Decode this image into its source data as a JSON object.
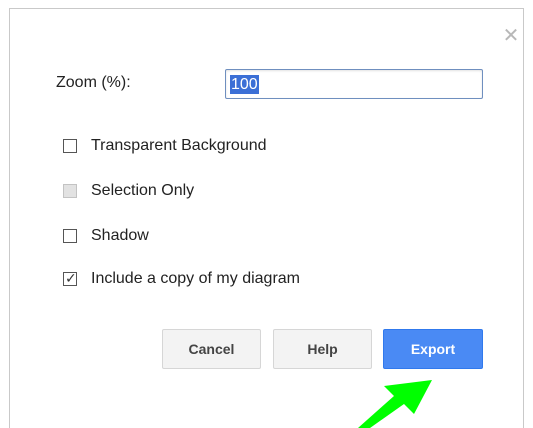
{
  "dialog": {
    "close_icon": "close-icon",
    "zoom_label": "Zoom (%):",
    "zoom_value": "100"
  },
  "options": [
    {
      "label": "Transparent Background",
      "checked": false,
      "disabled": false
    },
    {
      "label": "Selection Only",
      "checked": false,
      "disabled": true
    },
    {
      "label": "Shadow",
      "checked": false,
      "disabled": false
    },
    {
      "label": "Include a copy of my diagram",
      "checked": true,
      "disabled": false
    }
  ],
  "buttons": {
    "cancel": "Cancel",
    "help": "Help",
    "export": "Export"
  },
  "colors": {
    "accent": "#4a8af4",
    "arrow": "#00ff00"
  }
}
